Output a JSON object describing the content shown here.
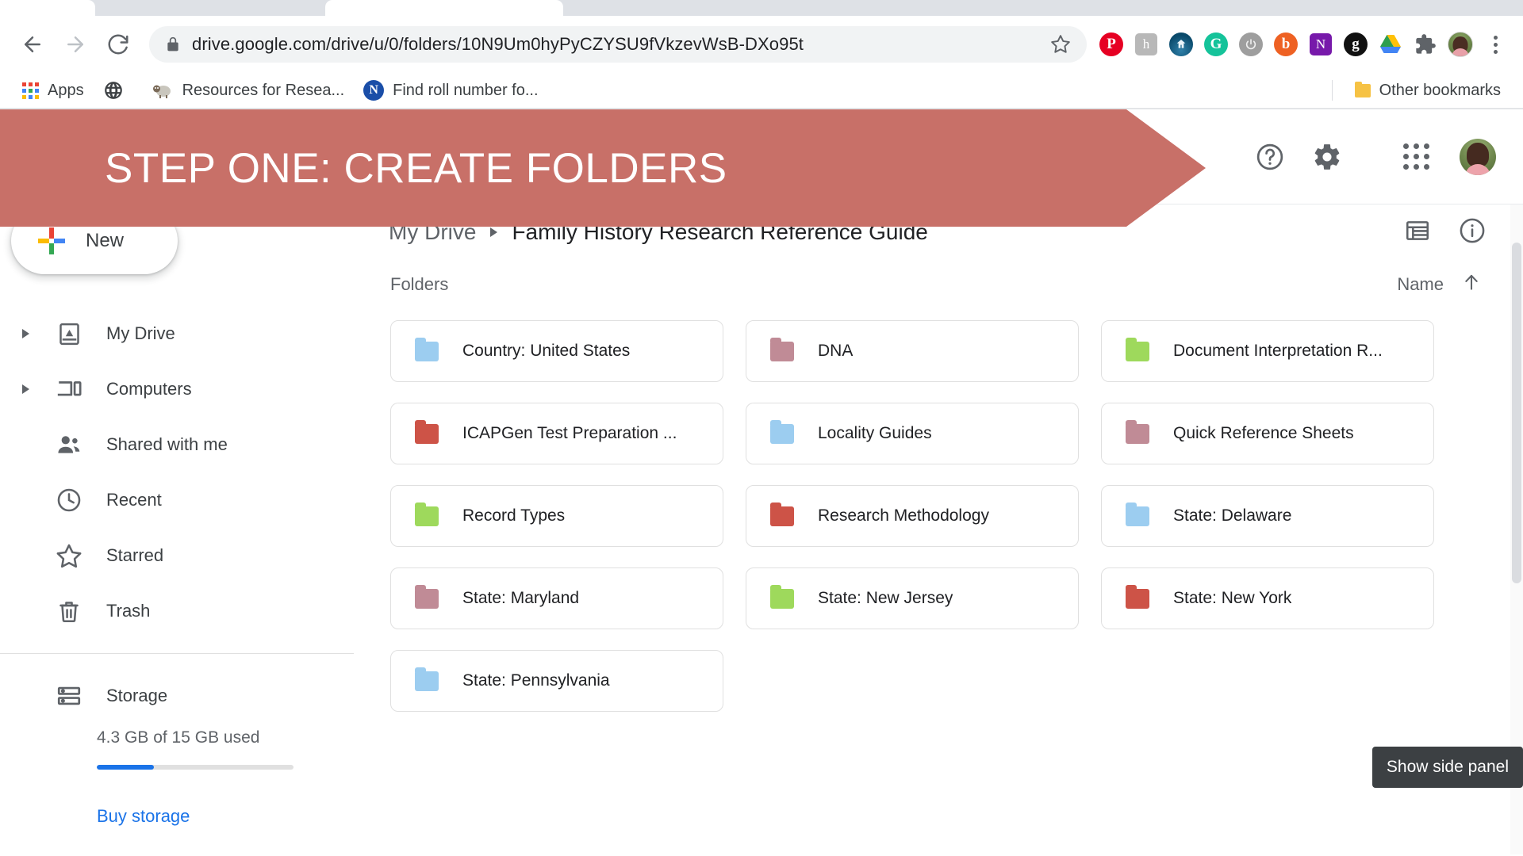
{
  "browser": {
    "nav": {
      "back": "back-arrow",
      "forward": "forward-arrow",
      "reload": "reload-arrow"
    },
    "url": "drive.google.com/drive/u/0/folders/10N9Um0hyPyCZYSU9fVkzevWsB-DXo95t",
    "lock_icon": "lock-icon",
    "star_icon": "star-icon",
    "extensions": [
      {
        "name": "pinterest-extension",
        "glyph": "P",
        "bg": "#e60023",
        "shape": "circle"
      },
      {
        "name": "honey-extension",
        "glyph": "h",
        "bg": "#b8b8b8",
        "shape": "square"
      },
      {
        "name": "familysearch-extension",
        "glyph": "⌂",
        "bg": "#0a4a6b",
        "shape": "circle"
      },
      {
        "name": "grammarly-extension",
        "glyph": "G",
        "bg": "#15c39a",
        "shape": "circle"
      },
      {
        "name": "power-extension",
        "glyph": "⏻",
        "bg": "#9e9e9e",
        "shape": "circle"
      },
      {
        "name": "bitly-extension",
        "glyph": "b",
        "bg": "#ee6123",
        "shape": "circle"
      },
      {
        "name": "onenote-extension",
        "glyph": "N",
        "bg": "#7719aa",
        "shape": "square"
      },
      {
        "name": "goodreads-extension",
        "glyph": "g",
        "bg": "#111111",
        "shape": "circle"
      },
      {
        "name": "google-drive-extension",
        "glyph": "△",
        "bg": "#ffffff",
        "shape": "drive"
      }
    ],
    "puzzle_icon": "puzzle-piece-icon",
    "profile_icon": "browser-profile-avatar",
    "menu_icon": "chrome-menu-icon",
    "bookmarks": {
      "apps_label": "Apps",
      "items": [
        {
          "label": "",
          "icon": "globe-icon"
        },
        {
          "label": "Resources for Resea...",
          "icon": "sheep-icon"
        },
        {
          "label": "Find roll number fo...",
          "icon": "onenote-icon"
        }
      ],
      "other_bookmarks": "Other bookmarks",
      "other_bookmarks_icon": "folder-icon"
    }
  },
  "banner": {
    "text": "STEP ONE:  CREATE FOLDERS",
    "color": "#c87068"
  },
  "drive": {
    "header_icons": [
      {
        "name": "help-icon",
        "glyph": "?"
      },
      {
        "name": "settings-gear-icon",
        "glyph": "gear"
      },
      {
        "name": "google-apps-grid-icon",
        "glyph": "grid"
      },
      {
        "name": "account-avatar",
        "glyph": "avatar"
      }
    ],
    "breadcrumb": {
      "root": "My Drive",
      "current": "Family History Research Reference Guide"
    },
    "view_icons": [
      {
        "name": "list-view-icon"
      },
      {
        "name": "details-info-icon"
      }
    ],
    "sidebar": {
      "new_button": "New",
      "items": [
        {
          "label": "My Drive",
          "icon": "drive-icon",
          "caret": true
        },
        {
          "label": "Computers",
          "icon": "computer-icon",
          "caret": true
        },
        {
          "label": "Shared with me",
          "icon": "people-icon",
          "caret": false
        },
        {
          "label": "Recent",
          "icon": "clock-icon",
          "caret": false
        },
        {
          "label": "Starred",
          "icon": "star-outline-icon",
          "caret": false
        },
        {
          "label": "Trash",
          "icon": "trash-icon",
          "caret": false
        },
        {
          "label": "Storage",
          "icon": "storage-icon",
          "caret": false
        }
      ],
      "storage_text": "4.3 GB of 15 GB used",
      "storage_percent": 29,
      "buy_storage": "Buy storage"
    },
    "list": {
      "section_title": "Folders",
      "sort_label": "Name",
      "sort_direction_icon": "arrow-up-icon"
    },
    "folders": [
      {
        "name": "Country: United States",
        "color": "#9ccdf0"
      },
      {
        "name": "DNA",
        "color": "#c08b96"
      },
      {
        "name": "Document Interpretation R...",
        "color": "#9ed95c"
      },
      {
        "name": "ICAPGen Test Preparation ...",
        "color": "#cd5347"
      },
      {
        "name": "Locality Guides",
        "color": "#9ccdf0"
      },
      {
        "name": "Quick Reference Sheets",
        "color": "#c08b96"
      },
      {
        "name": "Record Types",
        "color": "#9ed95c"
      },
      {
        "name": "Research Methodology",
        "color": "#cd5347"
      },
      {
        "name": "State: Delaware",
        "color": "#9ccdf0"
      },
      {
        "name": "State: Maryland",
        "color": "#c08b96"
      },
      {
        "name": "State: New Jersey",
        "color": "#9ed95c"
      },
      {
        "name": "State: New York",
        "color": "#cd5347"
      },
      {
        "name": "State: Pennsylvania",
        "color": "#9ccdf0"
      }
    ],
    "tooltip": "Show side panel"
  }
}
